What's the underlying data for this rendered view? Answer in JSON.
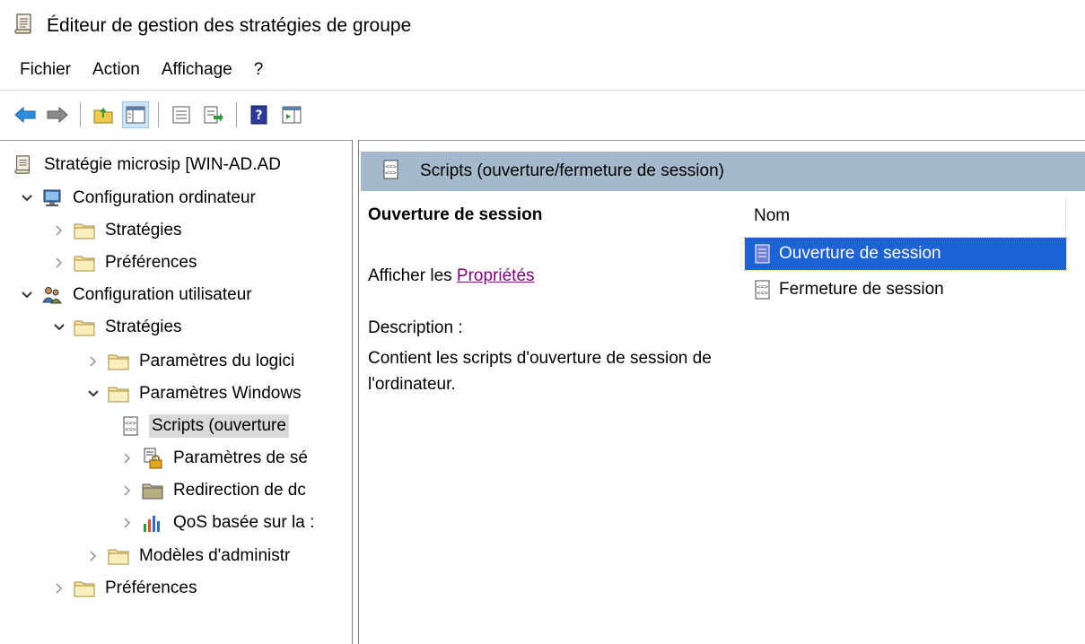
{
  "window": {
    "title": "Éditeur de gestion des stratégies de groupe",
    "icon": "policy-doc-icon"
  },
  "menu": {
    "items": [
      "Fichier",
      "Action",
      "Affichage",
      "?"
    ]
  },
  "toolbar": {
    "buttons": [
      "back-arrow-icon",
      "forward-arrow-icon",
      "up-folder-icon",
      "show-hide-tree-icon",
      "properties-icon",
      "export-list-icon",
      "help-icon",
      "show-hide-action-pane-icon"
    ],
    "pressed": "show-hide-tree-icon"
  },
  "tree": {
    "items": [
      {
        "label": "Stratégie microsip [WIN-AD.AD",
        "icon": "policy-doc-icon",
        "expander": "none"
      },
      {
        "label": "Configuration ordinateur",
        "icon": "computer-icon",
        "expander": "expanded"
      },
      {
        "label": "Stratégies",
        "icon": "folder-icon",
        "expander": "collapsed"
      },
      {
        "label": "Préférences",
        "icon": "folder-icon",
        "expander": "collapsed"
      },
      {
        "label": "Configuration utilisateur",
        "icon": "users-icon",
        "expander": "expanded"
      },
      {
        "label": "Stratégies",
        "icon": "folder-icon",
        "expander": "expanded"
      },
      {
        "label": "Paramètres du logici",
        "icon": "folder-icon",
        "expander": "collapsed"
      },
      {
        "label": "Paramètres Windows",
        "icon": "folder-icon",
        "expander": "expanded"
      },
      {
        "label": "Scripts (ouverture",
        "icon": "script-icon",
        "expander": "none",
        "selected": true
      },
      {
        "label": "Paramètres de sé",
        "icon": "security-settings-icon",
        "expander": "collapsed"
      },
      {
        "label": "Redirection de dc",
        "icon": "folder-redirection-icon",
        "expander": "collapsed"
      },
      {
        "label": "QoS basée sur la :",
        "icon": "qos-chart-icon",
        "expander": "collapsed"
      },
      {
        "label": "Modèles d'administr",
        "icon": "folder-icon",
        "expander": "collapsed"
      },
      {
        "label": "Préférences",
        "icon": "folder-icon",
        "expander": "collapsed"
      }
    ]
  },
  "details": {
    "header_title": "Scripts (ouverture/fermeture de session)",
    "heading": "Ouverture de session",
    "props_prefix": "Afficher les ",
    "props_link": "Propriétés",
    "description_label": "Description :",
    "description": "Contient les scripts d'ouverture de session de l'ordinateur."
  },
  "list": {
    "column": "Nom",
    "items": [
      {
        "label": "Ouverture de session",
        "icon": "script-icon",
        "selected": true
      },
      {
        "label": "Fermeture de session",
        "icon": "script-icon",
        "selected": false
      }
    ]
  },
  "colors": {
    "header_band": "#a5b9cc",
    "selection": "#1e63d6",
    "tree_selection": "#d9d9d9",
    "visited_link": "#800080"
  }
}
